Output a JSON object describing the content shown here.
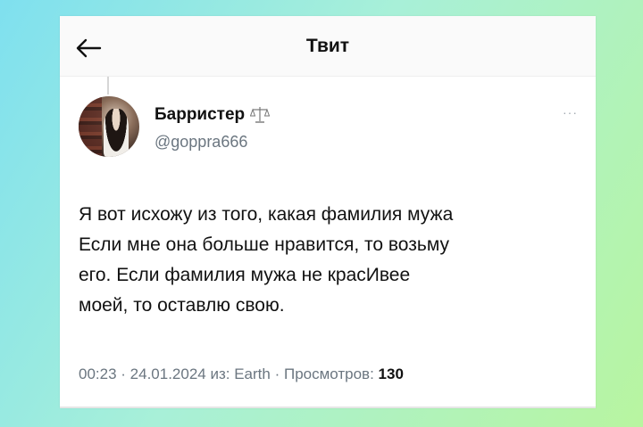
{
  "header": {
    "title": "Твит",
    "back_icon": "arrow-left-icon"
  },
  "author": {
    "name": "Барристер",
    "badge_icon": "scales-icon",
    "handle": "@goppra666",
    "more_icon": "more-dots-icon",
    "more_label": "···"
  },
  "tweet": {
    "lines": [
      "Я вот исхожу из того, какая фамилия мужа",
      "Если мне она больше нравится, то возьму",
      "его. Если фамилия мужа не красИвее",
      "моей, то оставлю свою."
    ]
  },
  "meta": {
    "time": "00:23",
    "sep1": " · ",
    "date": "24.01.2024",
    "source_prefix": " из: ",
    "source": "Earth",
    "sep2": " · ",
    "views_label": "Просмотров: ",
    "views_count": "130"
  },
  "colors": {
    "background_start": "#7fe0ef",
    "background_end": "#b8f5a0",
    "card": "#ffffff",
    "text": "#111111",
    "muted": "#6b7680"
  }
}
